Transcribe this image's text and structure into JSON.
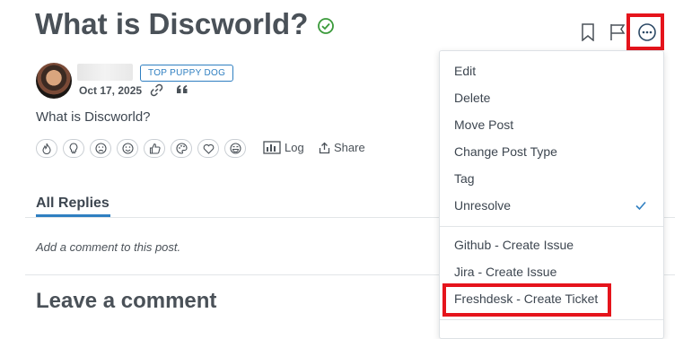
{
  "post": {
    "title": "What is Discworld?",
    "badge": "TOP PUPPY DOG",
    "date": "Oct 17, 2025",
    "body": "What is Discworld?"
  },
  "actions": {
    "log": "Log",
    "share": "Share"
  },
  "reactions": [
    "fire-icon",
    "lightbulb-icon",
    "sad-face-icon",
    "smile-icon",
    "thumbs-up-icon",
    "palette-icon",
    "heart-icon",
    "laugh-icon"
  ],
  "tabs": {
    "all_replies": "All Replies"
  },
  "comments": {
    "placeholder": "Add a comment to this post.",
    "leave_heading": "Leave a comment"
  },
  "menu": {
    "items": [
      "Edit",
      "Delete",
      "Move Post",
      "Change Post Type",
      "Tag",
      "Unresolve"
    ],
    "integrations": [
      "Github - Create Issue",
      "Jira - Create Issue",
      "Freshdesk - Create Ticket"
    ]
  },
  "colors": {
    "accent": "#2f7fc1",
    "highlight": "#e5141c",
    "resolved": "#3a9a3a"
  }
}
